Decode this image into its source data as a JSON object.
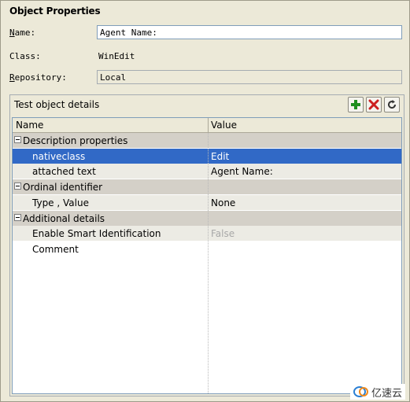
{
  "dialog": {
    "title": "Object Properties",
    "name_label_key": "N",
    "name_label_rest": "ame:",
    "name_value": "Agent Name:",
    "class_label": "Class:",
    "class_value": "WinEdit",
    "repo_label_key": "R",
    "repo_label_rest": "epository:",
    "repo_value": "Local"
  },
  "details": {
    "header": "Test object details",
    "buttons": {
      "add_icon": "plus-icon",
      "delete_icon": "x-icon",
      "refresh_icon": "refresh-icon"
    },
    "columns": {
      "name": "Name",
      "value": "Value"
    },
    "rows": [
      {
        "type": "category",
        "name": "Description properties",
        "value": ""
      },
      {
        "type": "property",
        "name": "nativeclass",
        "value": "Edit",
        "selected": true
      },
      {
        "type": "property",
        "name": "attached text",
        "value": "Agent Name:"
      },
      {
        "type": "category",
        "name": "Ordinal identifier",
        "value": ""
      },
      {
        "type": "property",
        "name": "Type , Value",
        "value": "None"
      },
      {
        "type": "category",
        "name": "Additional details",
        "value": ""
      },
      {
        "type": "property",
        "name": "Enable Smart Identification",
        "value": "False",
        "disabled": true
      },
      {
        "type": "property",
        "name": "Comment",
        "value": ""
      }
    ]
  },
  "watermark": {
    "text": "亿速云"
  },
  "colors": {
    "selection": "#3169c6",
    "add": "#1f8f1f",
    "delete": "#cc1f1f",
    "panel": "#ece9d8"
  }
}
